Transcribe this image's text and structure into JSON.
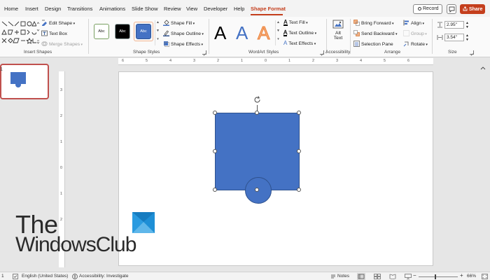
{
  "menu": {
    "tabs": [
      "Home",
      "Insert",
      "Design",
      "Transitions",
      "Animations",
      "Slide Show",
      "Review",
      "View",
      "Developer",
      "Help",
      "Shape Format"
    ],
    "active_tab": "Shape Format",
    "record_label": "Record",
    "share_label": "Share"
  },
  "ribbon": {
    "insert_shapes": {
      "label": "Insert Shapes",
      "edit_shape": "Edit Shape",
      "text_box": "Text Box",
      "merge_shapes": "Merge Shapes"
    },
    "shape_styles": {
      "label": "Shape Styles",
      "swatch_text": "Abc",
      "shape_fill": "Shape Fill",
      "shape_outline": "Shape Outline",
      "shape_effects": "Shape Effects"
    },
    "wordart_styles": {
      "label": "WordArt Styles",
      "letter": "A",
      "text_fill": "Text Fill",
      "text_outline": "Text Outline",
      "text_effects": "Text Effects"
    },
    "accessibility": {
      "label": "Accessibility",
      "alt_text_line1": "Alt",
      "alt_text_line2": "Text"
    },
    "arrange": {
      "label": "Arrange",
      "bring_forward": "Bring Forward",
      "send_backward": "Send Backward",
      "selection_pane": "Selection Pane",
      "align": "Align",
      "group": "Group",
      "rotate": "Rotate"
    },
    "size": {
      "label": "Size",
      "height": "2.95\"",
      "width": "3.54\""
    }
  },
  "thumbnails": {
    "slide_number": "1"
  },
  "rulers": {
    "horizontal": [
      "6",
      "5",
      "4",
      "3",
      "2",
      "1",
      "0",
      "1",
      "2",
      "3",
      "4",
      "5",
      "6"
    ],
    "vertical": [
      "3",
      "2",
      "1",
      "0",
      "1",
      "2",
      "3"
    ]
  },
  "watermark": {
    "line1": "The",
    "line2": "WindowsClub"
  },
  "status": {
    "slide_indicator": "1",
    "language": "English (United States)",
    "accessibility": "Accessibility: Investigate",
    "notes": "Notes",
    "zoom": "66%"
  },
  "colors": {
    "accent": "#c43e1c",
    "shape_fill": "#4472c4",
    "shape_outline": "#2f528f"
  }
}
